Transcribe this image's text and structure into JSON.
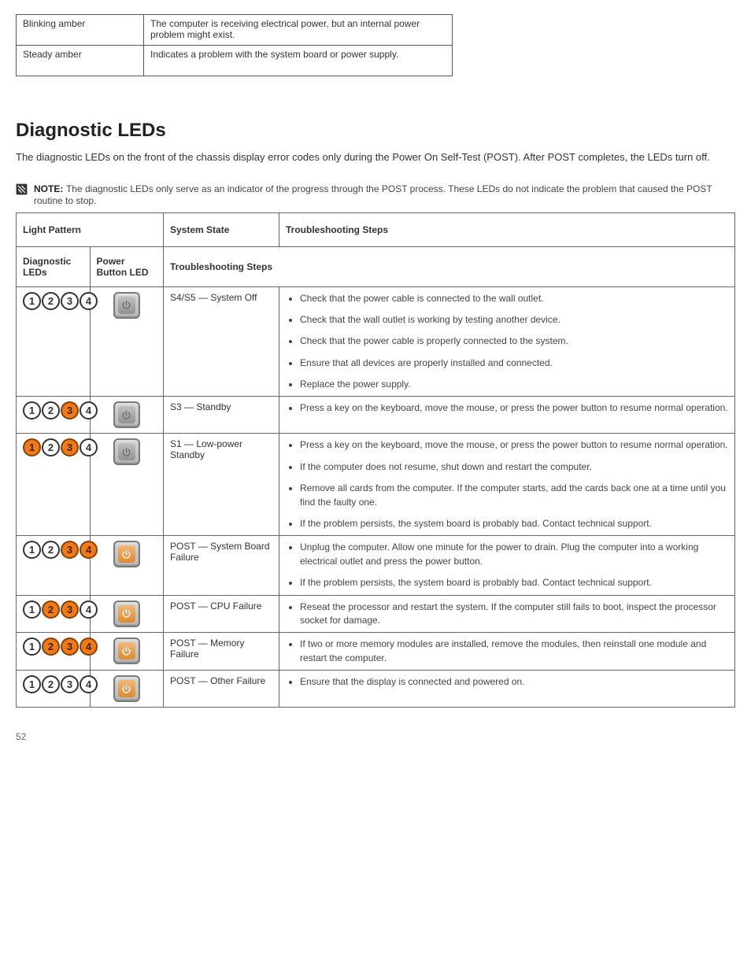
{
  "top_table": {
    "row1": {
      "left": "Blinking amber",
      "right": "The computer is receiving electrical power, but an internal power problem might exist."
    },
    "row2": {
      "left": "Steady amber",
      "right": "Indicates a problem with the system board or power supply."
    }
  },
  "section": {
    "title": "Diagnostic LEDs",
    "intro": "The diagnostic LEDs on the front of the chassis display error codes only during the Power On Self-Test (POST). After POST completes, the LEDs turn off.",
    "note_label": "NOTE:",
    "note_text": "The diagnostic LEDs only serve as an indicator of the progress through the POST process. These LEDs do not indicate the problem that caused the POST routine to stop."
  },
  "table_headers": {
    "h1": "Light Pattern",
    "h2": "System State",
    "h3": "Troubleshooting Steps",
    "sub1": "Diagnostic LEDs",
    "sub2": "Power Button LED",
    "sub3": "Troubleshooting Steps"
  },
  "rows": [
    {
      "leds": [
        false,
        false,
        false,
        false
      ],
      "power": "off",
      "state": "S4/S5 — System Off",
      "steps": [
        "Check that the power cable is connected to the wall outlet.",
        "Check that the wall outlet is working by testing another device.",
        "Check that the power cable is properly connected to the system.",
        "Ensure that all devices are properly installed and connected.",
        "Replace the power supply."
      ]
    },
    {
      "leds": [
        false,
        false,
        true,
        false
      ],
      "power": "off",
      "state": "S3 — Standby",
      "steps": [
        "Press a key on the keyboard, move the mouse, or press the power button to resume normal operation."
      ]
    },
    {
      "leds": [
        true,
        false,
        true,
        false
      ],
      "power": "off",
      "state": "S1 — Low-power Standby",
      "steps": [
        "Press a key on the keyboard, move the mouse, or press the power button to resume normal operation.",
        "If the computer does not resume, shut down and restart the computer.",
        "Remove all cards from the computer. If the computer starts, add the cards back one at a time until you find the faulty one.",
        "If the problem persists, the system board is probably bad. Contact technical support."
      ]
    },
    {
      "leds": [
        false,
        false,
        true,
        true
      ],
      "power": "amber",
      "state": "POST — System Board Failure",
      "steps": [
        "Unplug the computer. Allow one minute for the power to drain. Plug the computer into a working electrical outlet and press the power button.",
        "If the problem persists, the system board is probably bad. Contact technical support."
      ]
    },
    {
      "leds": [
        false,
        true,
        true,
        false
      ],
      "power": "amber",
      "state": "POST — CPU Failure",
      "steps": [
        "Reseat the processor and restart the system. If the computer still fails to boot, inspect the processor socket for damage."
      ]
    },
    {
      "leds": [
        false,
        true,
        true,
        true
      ],
      "power": "amber",
      "state": "POST — Memory Failure",
      "steps": [
        "If two or more memory modules are installed, remove the modules, then reinstall one module and restart the computer."
      ]
    },
    {
      "leds": [
        false,
        false,
        false,
        false
      ],
      "power": "amber",
      "state": "POST — Other Failure",
      "steps": [
        "Ensure that the display is connected and powered on."
      ]
    }
  ],
  "footer": "52"
}
